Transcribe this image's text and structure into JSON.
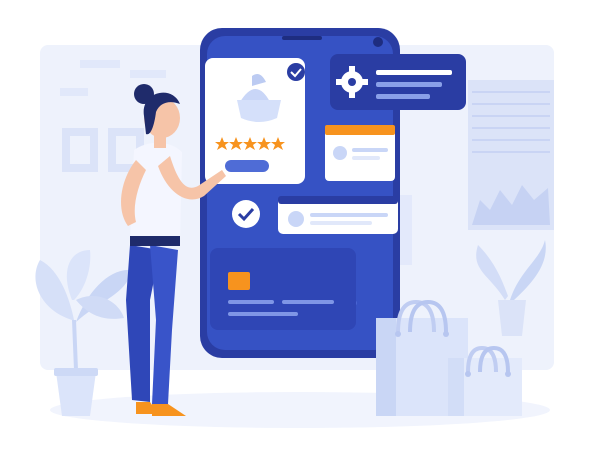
{
  "scene": {
    "product_card": {
      "rating_stars": 5,
      "verified": true
    },
    "settings_card": {
      "icon": "gear-icon"
    },
    "chat_card": {
      "icon": "avatar-icon"
    },
    "review_card": {
      "icon": "avatar-icon"
    },
    "check_badge": {
      "icon": "check-icon"
    },
    "payment_card": {
      "icon": "chip-icon"
    },
    "shopping_bags": {
      "count": 2
    },
    "plants": {
      "count": 2
    }
  },
  "colors": {
    "phone_body": "#2b3fa8",
    "phone_screen": "#3550c2",
    "card_white": "#ffffff",
    "accent_orange": "#f7931e",
    "background_panel": "#e9eefb",
    "light_blue": "#c9d6f7",
    "shirt_white": "#f5f7ff",
    "pants_blue": "#2f47b8",
    "hair_navy": "#1f2b6b",
    "skin": "#f6c4a8",
    "shoes_orange": "#f7931e"
  }
}
